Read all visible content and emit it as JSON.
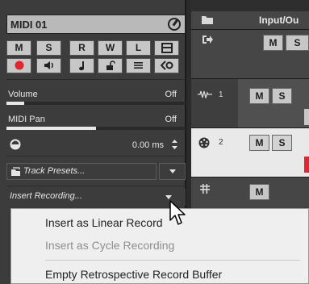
{
  "inspector": {
    "track_name": "MIDI 01",
    "buttons_row1": [
      "M",
      "S",
      "R",
      "W",
      "L"
    ],
    "volume": {
      "label": "Volume",
      "value": "Off",
      "level": 0.1
    },
    "midi_pan": {
      "label": "MIDI Pan",
      "value": "Off",
      "level": 0.5
    },
    "delay": {
      "value": "0.00 ms"
    },
    "track_presets_placeholder": "Track Presets...",
    "insert_recording_label": "Insert Recording..."
  },
  "tracklist": {
    "header_label": "Input/Ou",
    "tracks": [
      {
        "number": "",
        "type": "folder",
        "m": "M",
        "s": "S"
      },
      {
        "number": "1",
        "type": "audio",
        "m": "M",
        "s": "S"
      },
      {
        "number": "2",
        "type": "midi",
        "m": "M",
        "s": "S",
        "selected": true
      },
      {
        "number": "",
        "type": "group",
        "m": "M"
      }
    ]
  },
  "context_menu": {
    "items": [
      {
        "label": "Insert as Linear Record",
        "enabled": true
      },
      {
        "label": "Insert as Cycle Recording",
        "enabled": false
      },
      {
        "label": "Empty Retrospective Record Buffer",
        "enabled": true
      }
    ]
  },
  "colors": {
    "record_red": "#e0262e",
    "panel": "#3c3c3c",
    "menu_bg": "#efefef"
  }
}
